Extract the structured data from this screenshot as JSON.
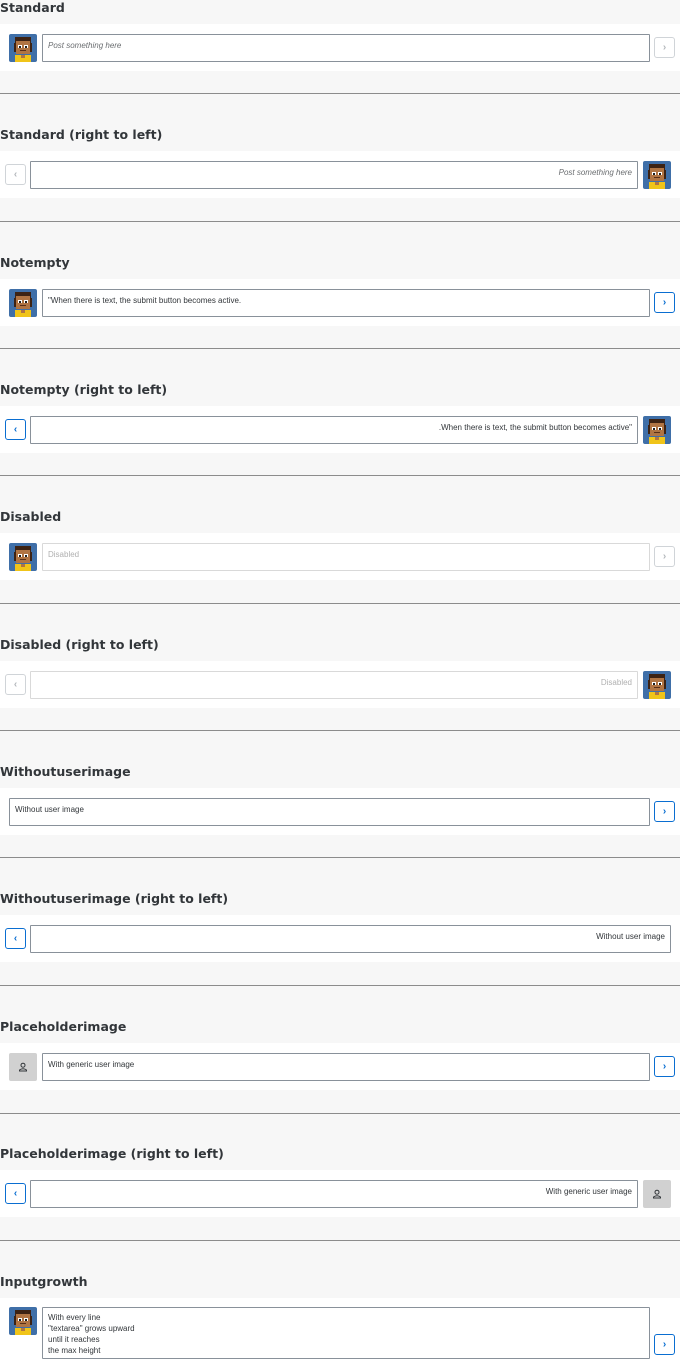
{
  "sections": [
    {
      "title": "Standard",
      "placeholder": "Post something here",
      "value": "",
      "button": "›"
    },
    {
      "title": "Standard (right to left)",
      "placeholder": "Post something here",
      "value": "",
      "button": "‹"
    },
    {
      "title": "Notempty",
      "value": "\"When there is text, the submit button becomes active.",
      "button": "›"
    },
    {
      "title": "Notempty (right to left)",
      "value": ".When there is text, the submit button becomes active\"",
      "button": "‹"
    },
    {
      "title": "Disabled",
      "placeholder": "Disabled",
      "value": "",
      "button": "›"
    },
    {
      "title": "Disabled (right to left)",
      "placeholder": "Disabled",
      "value": "",
      "button": "‹"
    },
    {
      "title": "Withoutuserimage",
      "value": "Without user image",
      "button": "›"
    },
    {
      "title": "Withoutuserimage (right to left)",
      "value": "Without user image",
      "button": "‹"
    },
    {
      "title": "Placeholderimage",
      "value": "With generic user image",
      "button": "›"
    },
    {
      "title": "Placeholderimage (right to left)",
      "value": "With generic user image",
      "button": "‹"
    },
    {
      "title": "Inputgrowth",
      "value": "With every line\n\"textarea\" grows upward\nuntil it reaches\nthe max height",
      "button": "›"
    }
  ],
  "colors": {
    "accent": "#0a6ed1",
    "background": "#f7f7f7",
    "band": "#ffffff",
    "avatar_bg": "#3f6fa8"
  },
  "icons": {
    "user_avatar": "user-avatar-illustration",
    "generic_avatar": "person-icon"
  }
}
